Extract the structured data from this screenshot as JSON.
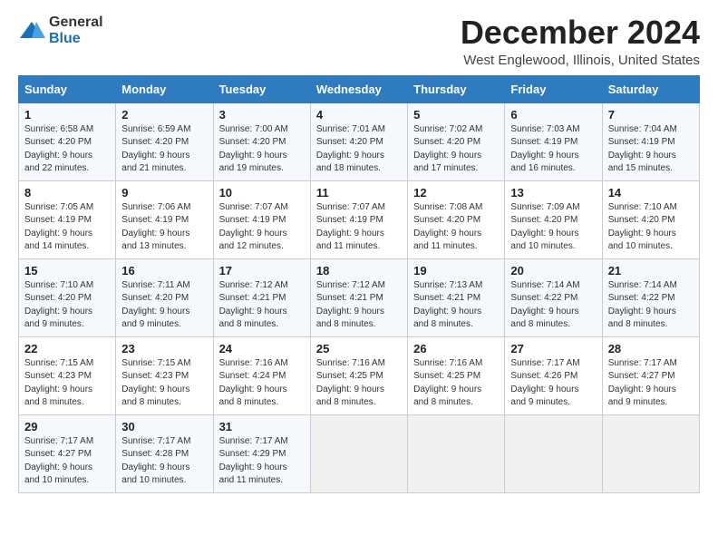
{
  "logo": {
    "general": "General",
    "blue": "Blue"
  },
  "title": "December 2024",
  "location": "West Englewood, Illinois, United States",
  "days_header": [
    "Sunday",
    "Monday",
    "Tuesday",
    "Wednesday",
    "Thursday",
    "Friday",
    "Saturday"
  ],
  "weeks": [
    [
      {
        "day": "1",
        "sunrise": "6:58 AM",
        "sunset": "4:20 PM",
        "daylight": "9 hours and 22 minutes."
      },
      {
        "day": "2",
        "sunrise": "6:59 AM",
        "sunset": "4:20 PM",
        "daylight": "9 hours and 21 minutes."
      },
      {
        "day": "3",
        "sunrise": "7:00 AM",
        "sunset": "4:20 PM",
        "daylight": "9 hours and 19 minutes."
      },
      {
        "day": "4",
        "sunrise": "7:01 AM",
        "sunset": "4:20 PM",
        "daylight": "9 hours and 18 minutes."
      },
      {
        "day": "5",
        "sunrise": "7:02 AM",
        "sunset": "4:20 PM",
        "daylight": "9 hours and 17 minutes."
      },
      {
        "day": "6",
        "sunrise": "7:03 AM",
        "sunset": "4:19 PM",
        "daylight": "9 hours and 16 minutes."
      },
      {
        "day": "7",
        "sunrise": "7:04 AM",
        "sunset": "4:19 PM",
        "daylight": "9 hours and 15 minutes."
      }
    ],
    [
      {
        "day": "8",
        "sunrise": "7:05 AM",
        "sunset": "4:19 PM",
        "daylight": "9 hours and 14 minutes."
      },
      {
        "day": "9",
        "sunrise": "7:06 AM",
        "sunset": "4:19 PM",
        "daylight": "9 hours and 13 minutes."
      },
      {
        "day": "10",
        "sunrise": "7:07 AM",
        "sunset": "4:19 PM",
        "daylight": "9 hours and 12 minutes."
      },
      {
        "day": "11",
        "sunrise": "7:07 AM",
        "sunset": "4:19 PM",
        "daylight": "9 hours and 11 minutes."
      },
      {
        "day": "12",
        "sunrise": "7:08 AM",
        "sunset": "4:20 PM",
        "daylight": "9 hours and 11 minutes."
      },
      {
        "day": "13",
        "sunrise": "7:09 AM",
        "sunset": "4:20 PM",
        "daylight": "9 hours and 10 minutes."
      },
      {
        "day": "14",
        "sunrise": "7:10 AM",
        "sunset": "4:20 PM",
        "daylight": "9 hours and 10 minutes."
      }
    ],
    [
      {
        "day": "15",
        "sunrise": "7:10 AM",
        "sunset": "4:20 PM",
        "daylight": "9 hours and 9 minutes."
      },
      {
        "day": "16",
        "sunrise": "7:11 AM",
        "sunset": "4:20 PM",
        "daylight": "9 hours and 9 minutes."
      },
      {
        "day": "17",
        "sunrise": "7:12 AM",
        "sunset": "4:21 PM",
        "daylight": "9 hours and 8 minutes."
      },
      {
        "day": "18",
        "sunrise": "7:12 AM",
        "sunset": "4:21 PM",
        "daylight": "9 hours and 8 minutes."
      },
      {
        "day": "19",
        "sunrise": "7:13 AM",
        "sunset": "4:21 PM",
        "daylight": "9 hours and 8 minutes."
      },
      {
        "day": "20",
        "sunrise": "7:14 AM",
        "sunset": "4:22 PM",
        "daylight": "9 hours and 8 minutes."
      },
      {
        "day": "21",
        "sunrise": "7:14 AM",
        "sunset": "4:22 PM",
        "daylight": "9 hours and 8 minutes."
      }
    ],
    [
      {
        "day": "22",
        "sunrise": "7:15 AM",
        "sunset": "4:23 PM",
        "daylight": "9 hours and 8 minutes."
      },
      {
        "day": "23",
        "sunrise": "7:15 AM",
        "sunset": "4:23 PM",
        "daylight": "9 hours and 8 minutes."
      },
      {
        "day": "24",
        "sunrise": "7:16 AM",
        "sunset": "4:24 PM",
        "daylight": "9 hours and 8 minutes."
      },
      {
        "day": "25",
        "sunrise": "7:16 AM",
        "sunset": "4:25 PM",
        "daylight": "9 hours and 8 minutes."
      },
      {
        "day": "26",
        "sunrise": "7:16 AM",
        "sunset": "4:25 PM",
        "daylight": "9 hours and 8 minutes."
      },
      {
        "day": "27",
        "sunrise": "7:17 AM",
        "sunset": "4:26 PM",
        "daylight": "9 hours and 9 minutes."
      },
      {
        "day": "28",
        "sunrise": "7:17 AM",
        "sunset": "4:27 PM",
        "daylight": "9 hours and 9 minutes."
      }
    ],
    [
      {
        "day": "29",
        "sunrise": "7:17 AM",
        "sunset": "4:27 PM",
        "daylight": "9 hours and 10 minutes."
      },
      {
        "day": "30",
        "sunrise": "7:17 AM",
        "sunset": "4:28 PM",
        "daylight": "9 hours and 10 minutes."
      },
      {
        "day": "31",
        "sunrise": "7:17 AM",
        "sunset": "4:29 PM",
        "daylight": "9 hours and 11 minutes."
      },
      null,
      null,
      null,
      null
    ]
  ]
}
